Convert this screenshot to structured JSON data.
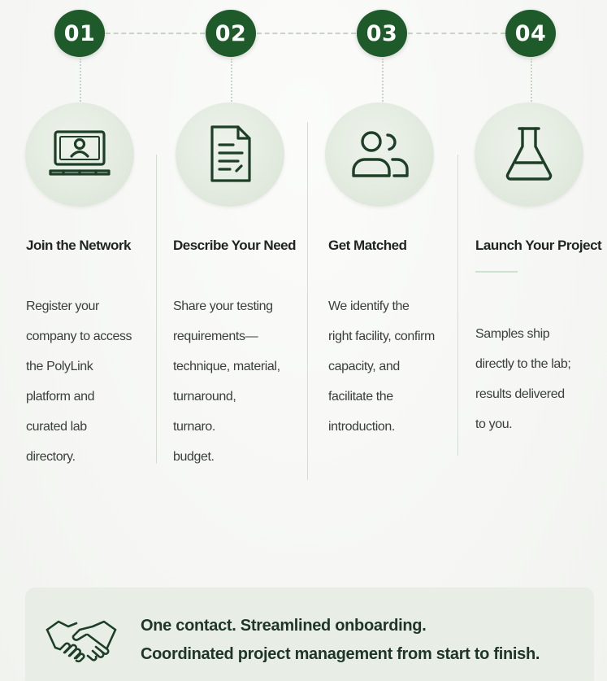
{
  "steps": [
    {
      "number": "01",
      "icon": "user-monitor-icon",
      "title": "Join the Network",
      "description": [
        "Register your",
        "company to access",
        "the PolyLink",
        "platform and",
        "curated lab",
        "directory."
      ]
    },
    {
      "number": "02",
      "icon": "document-icon",
      "title": "Describe Your Need",
      "description": [
        "Share your testing",
        "requirements—",
        "technique, material,",
        "turnaround,",
        "turnaro.",
        "budget."
      ]
    },
    {
      "number": "03",
      "icon": "people-icon",
      "title": "Get Matched",
      "description": [
        "We identify the",
        "right facility, confirm",
        "capacity, and",
        "facilitate the",
        "introduction."
      ]
    },
    {
      "number": "04",
      "icon": "flask-icon",
      "title": "Launch Your Project",
      "description": [
        "Samples ship",
        "directly to the lab;",
        "results delivered",
        "to you."
      ]
    }
  ],
  "callout": {
    "icon": "handshake-icon",
    "line1": "One contact. Streamlined onboarding.",
    "line2": "Coordinated project management from start to finish."
  },
  "colors": {
    "badge": "#1e5a2a",
    "icon_stroke": "#1e3f27",
    "callout_bg": "#e8eee6"
  }
}
